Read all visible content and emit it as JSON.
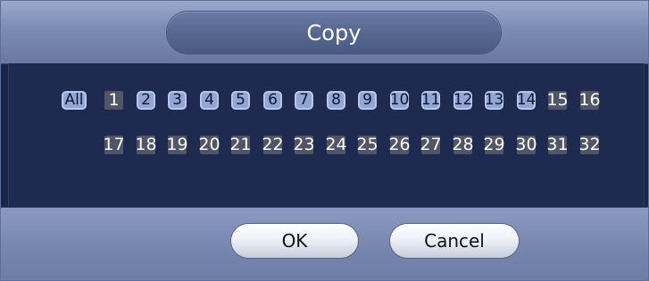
{
  "dialog": {
    "title": "Copy"
  },
  "channels": {
    "all_label": "All",
    "row1": [
      {
        "label": "1",
        "selected": false
      },
      {
        "label": "2",
        "selected": true
      },
      {
        "label": "3",
        "selected": true
      },
      {
        "label": "4",
        "selected": true
      },
      {
        "label": "5",
        "selected": true
      },
      {
        "label": "6",
        "selected": true
      },
      {
        "label": "7",
        "selected": true
      },
      {
        "label": "8",
        "selected": true
      },
      {
        "label": "9",
        "selected": true
      },
      {
        "label": "10",
        "selected": true
      },
      {
        "label": "11",
        "selected": true
      },
      {
        "label": "12",
        "selected": true
      },
      {
        "label": "13",
        "selected": true
      },
      {
        "label": "14",
        "selected": true
      },
      {
        "label": "15",
        "selected": false
      },
      {
        "label": "16",
        "selected": false
      }
    ],
    "row2": [
      {
        "label": "17",
        "selected": false
      },
      {
        "label": "18",
        "selected": false
      },
      {
        "label": "19",
        "selected": false
      },
      {
        "label": "20",
        "selected": false
      },
      {
        "label": "21",
        "selected": false
      },
      {
        "label": "22",
        "selected": false
      },
      {
        "label": "23",
        "selected": false
      },
      {
        "label": "24",
        "selected": false
      },
      {
        "label": "25",
        "selected": false
      },
      {
        "label": "26",
        "selected": false
      },
      {
        "label": "27",
        "selected": false
      },
      {
        "label": "28",
        "selected": false
      },
      {
        "label": "29",
        "selected": false
      },
      {
        "label": "30",
        "selected": false
      },
      {
        "label": "31",
        "selected": false
      },
      {
        "label": "32",
        "selected": false
      }
    ]
  },
  "buttons": {
    "ok": "OK",
    "cancel": "Cancel"
  }
}
